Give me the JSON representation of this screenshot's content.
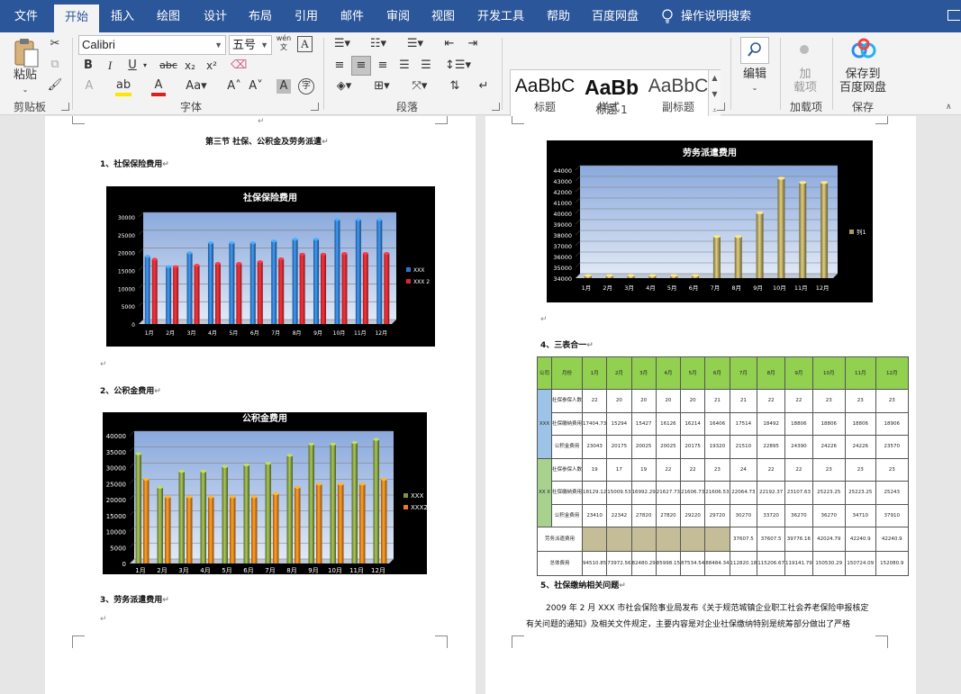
{
  "tabs": [
    "文件",
    "开始",
    "插入",
    "绘图",
    "设计",
    "布局",
    "引用",
    "邮件",
    "审阅",
    "视图",
    "开发工具",
    "帮助",
    "百度网盘"
  ],
  "tell_me": "操作说明搜索",
  "ribbon": {
    "paste": "粘贴",
    "clipboard": "剪贴板",
    "font_name": "Calibri",
    "font_size": "五号",
    "wen": "wén",
    "font_group": "字体",
    "para_group": "段落",
    "styles_group": "样式",
    "styles": [
      {
        "sample": "AaBbC",
        "name": "标题"
      },
      {
        "sample": "AaBb",
        "name": "标题 1"
      },
      {
        "sample": "AaBbC",
        "name": "副标题"
      }
    ],
    "edit": "编辑",
    "add_in_top": "加",
    "add_in_bottom": "载项",
    "add_in_group": "加载项",
    "save_top": "保存到",
    "save_bottom": "百度网盘",
    "save_group": "保存"
  },
  "doc": {
    "section_title": "第三节 社保、公积金及劳务派遣",
    "h1": "1、社保保险费用",
    "h2": "2、公积金费用",
    "h3": "3、劳务派遣费用",
    "h4": "4、三表合一",
    "h5": "5、社保缴纳相关问题",
    "para1": "2009 年 2 月 XXX 市社会保险事业局发布《关于规范城镇企业职工社会养老保险申报核定",
    "para2": "有关问题的通知》及相关文件规定，主要内容是对企业社保缴纳特别是统筹部分做出了严格"
  },
  "chart_data": [
    {
      "type": "bar",
      "title": "社保保险费用",
      "categories": [
        "1月",
        "2月",
        "3月",
        "4月",
        "5月",
        "6月",
        "7月",
        "8月",
        "9月",
        "10月",
        "11月",
        "12月"
      ],
      "yticks": [
        "0",
        "5000",
        "10000",
        "15000",
        "20000",
        "25000",
        "30000"
      ],
      "ylim": [
        0,
        30000
      ],
      "series": [
        {
          "name": "XXX",
          "color": "#2e75c8",
          "values": [
            18200,
            15300,
            19200,
            22000,
            22000,
            22000,
            22500,
            23000,
            23000,
            28500,
            28500,
            28500
          ]
        },
        {
          "name": "XXX 2",
          "color": "#e0262d",
          "values": [
            17400,
            15300,
            15700,
            16200,
            16200,
            16700,
            17500,
            18800,
            18800,
            19000,
            19000,
            19000
          ]
        }
      ]
    },
    {
      "type": "bar",
      "title": "公积金费用",
      "categories": [
        "1月",
        "2月",
        "3月",
        "4月",
        "5月",
        "6月",
        "7月",
        "8月",
        "9月",
        "10月",
        "11月",
        "12月"
      ],
      "yticks": [
        "0",
        "5000",
        "10000",
        "15000",
        "20000",
        "25000",
        "30000",
        "35000",
        "40000"
      ],
      "ylim": [
        0,
        40000
      ],
      "series": [
        {
          "name": "XXX",
          "color": "#7f9640",
          "values": [
            33500,
            23000,
            28000,
            28000,
            29500,
            30000,
            30500,
            33000,
            36500,
            36500,
            37000,
            38000
          ]
        },
        {
          "name": "XXX2",
          "color": "#ee7a1a",
          "values": [
            25500,
            20000,
            20000,
            20000,
            20000,
            20000,
            21000,
            23000,
            24000,
            24000,
            24000,
            25500
          ]
        }
      ]
    },
    {
      "type": "bar",
      "title": "劳务派遣费用",
      "categories": [
        "1月",
        "2月",
        "3月",
        "4月",
        "5月",
        "6月",
        "7月",
        "8月",
        "9月",
        "10月",
        "11月",
        "12月"
      ],
      "yticks": [
        "34000",
        "35000",
        "36000",
        "37000",
        "38000",
        "39000",
        "40000",
        "41000",
        "42000",
        "43000",
        "44000"
      ],
      "ylim": [
        34000,
        44000
      ],
      "series": [
        {
          "name": "列1",
          "color": "#a89a5c",
          "values": [
            34000,
            34000,
            34000,
            34000,
            34000,
            34000,
            37600,
            37600,
            39800,
            43000,
            42600,
            42600
          ]
        }
      ]
    }
  ],
  "table": {
    "header": [
      "公司",
      "月份",
      "1月",
      "2月",
      "3月",
      "4月",
      "5月",
      "6月",
      "7月",
      "8月",
      "9月",
      "10月",
      "11月",
      "12月"
    ],
    "companies": [
      "XXX",
      "XX X"
    ],
    "labels": [
      "社保参保人数",
      "社保缴纳费用",
      "公积金费用"
    ],
    "rows": [
      [
        "22",
        "20",
        "20",
        "20",
        "20",
        "21",
        "21",
        "22",
        "22",
        "23",
        "23",
        "23"
      ],
      [
        "17404.73",
        "15294",
        "15427",
        "16126",
        "16214",
        "16406",
        "17514",
        "18492",
        "18806",
        "18806",
        "18806",
        "18906"
      ],
      [
        "23043",
        "20175",
        "20025",
        "20025",
        "20175",
        "19320",
        "21510",
        "22895",
        "24390",
        "24226",
        "24226",
        "23570"
      ],
      [
        "19",
        "17",
        "19",
        "22",
        "22",
        "23",
        "24",
        "22",
        "22",
        "23",
        "23",
        "23"
      ],
      [
        "18129.12",
        "15009.53",
        "16992.29",
        "21627.73",
        "21606.73",
        "21606.53",
        "22064.73",
        "22192.37",
        "23107.63",
        "25223.25",
        "25223.25",
        "25243"
      ],
      [
        "23410",
        "22342",
        "27820",
        "27820",
        "29220",
        "29720",
        "30270",
        "33720",
        "36270",
        "36270",
        "34710",
        "37910"
      ]
    ],
    "lw_label": "劳务派遣费用",
    "lw_vals": [
      "37607.5",
      "37607.5",
      "39776.16",
      "42024.79",
      "42240.9",
      "42240.9"
    ],
    "total_label": "总体费用",
    "totals": [
      "94510.85",
      "73972.56",
      "82480.29",
      "85998.15",
      "87534.54",
      "88484.34",
      "112820.18",
      "115206.67",
      "119141.79",
      "150530.29",
      "150724.09",
      "152080.9"
    ]
  }
}
